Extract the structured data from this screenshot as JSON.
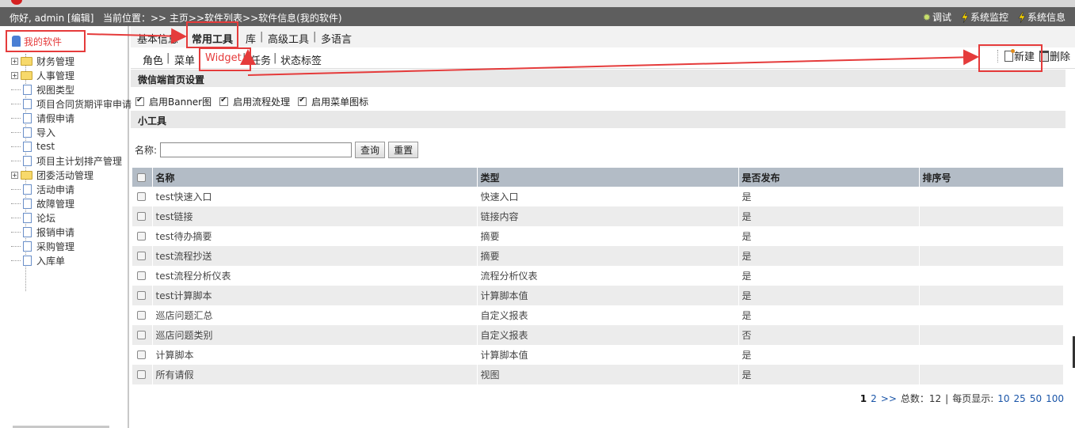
{
  "header": {
    "greeting": "你好, admin [编辑]",
    "breadcrumb": "当前位置：>> 主页>>软件列表>>软件信息(我的软件)",
    "links": [
      {
        "label": "调试",
        "icon": "gear-bug-icon"
      },
      {
        "label": "系统监控",
        "icon": "lightning-icon"
      },
      {
        "label": "系统信息",
        "icon": "lightning-icon"
      }
    ]
  },
  "sidebar": {
    "root_label": "我的软件",
    "items": [
      {
        "label": "财务管理",
        "type": "folder"
      },
      {
        "label": "人事管理",
        "type": "folder"
      },
      {
        "label": "视图类型",
        "type": "doc"
      },
      {
        "label": "项目合同货期评审申请",
        "type": "doc"
      },
      {
        "label": "请假申请",
        "type": "doc"
      },
      {
        "label": "导入",
        "type": "doc"
      },
      {
        "label": "test",
        "type": "doc"
      },
      {
        "label": "项目主计划排产管理",
        "type": "doc"
      },
      {
        "label": "团委活动管理",
        "type": "folder"
      },
      {
        "label": "活动申请",
        "type": "doc"
      },
      {
        "label": "故障管理",
        "type": "doc"
      },
      {
        "label": "论坛",
        "type": "doc"
      },
      {
        "label": "报销申请",
        "type": "doc"
      },
      {
        "label": "采购管理",
        "type": "doc"
      },
      {
        "label": "入库单",
        "type": "doc"
      }
    ]
  },
  "tabs_main": [
    "基本信息",
    "常用工具",
    "库",
    "高级工具",
    "多语言"
  ],
  "tabs_sub": [
    "角色",
    "菜单",
    "Widget",
    "任务",
    "状态标签"
  ],
  "toolbar": {
    "new_label": "新建",
    "delete_label": "删除"
  },
  "section_wechat": {
    "title": "微信端首页设置",
    "options": [
      {
        "label": "启用Banner图",
        "checked": true
      },
      {
        "label": "启用流程处理",
        "checked": true
      },
      {
        "label": "启用菜单图标",
        "checked": true
      }
    ]
  },
  "section_tools": {
    "title": "小工具"
  },
  "search": {
    "label": "名称:",
    "value": "",
    "query_label": "查询",
    "reset_label": "重置"
  },
  "table": {
    "headers": [
      "名称",
      "类型",
      "是否发布",
      "排序号"
    ],
    "rows": [
      {
        "name": "test快速入口",
        "type": "快速入口",
        "published": "是",
        "order": ""
      },
      {
        "name": "test链接",
        "type": "链接内容",
        "published": "是",
        "order": ""
      },
      {
        "name": "test待办摘要",
        "type": "摘要",
        "published": "是",
        "order": ""
      },
      {
        "name": "test流程抄送",
        "type": "摘要",
        "published": "是",
        "order": ""
      },
      {
        "name": "test流程分析仪表",
        "type": "流程分析仪表",
        "published": "是",
        "order": ""
      },
      {
        "name": "test计算脚本",
        "type": "计算脚本值",
        "published": "是",
        "order": ""
      },
      {
        "name": "巡店问题汇总",
        "type": "自定义报表",
        "published": "是",
        "order": ""
      },
      {
        "name": "巡店问题类别",
        "type": "自定义报表",
        "published": "否",
        "order": ""
      },
      {
        "name": "计算脚本",
        "type": "计算脚本值",
        "published": "是",
        "order": ""
      },
      {
        "name": "所有请假",
        "type": "视图",
        "published": "是",
        "order": ""
      }
    ]
  },
  "pager": {
    "pages": [
      "1",
      "2"
    ],
    "next": ">>",
    "total": "总数：12",
    "sep": "|",
    "per_page_label": "每页显示:",
    "per_page_options": [
      "10",
      "25",
      "50",
      "100"
    ]
  },
  "colors": {
    "annotation": "#e53b3b",
    "header_bg": "#5e5e5e",
    "table_header": "#b3bcc6"
  }
}
